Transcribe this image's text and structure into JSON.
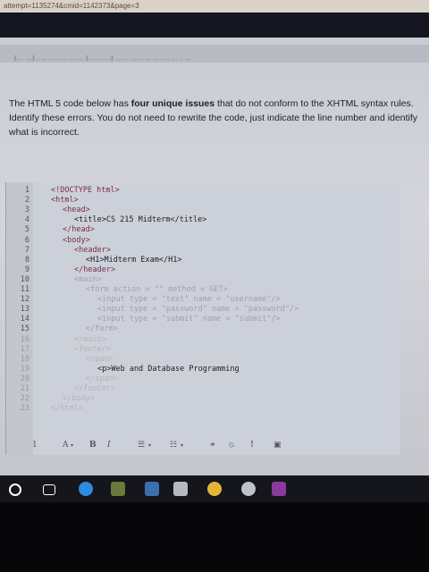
{
  "browser": {
    "url_fragment": "attempt=1135274&cmid=1142373&page=3"
  },
  "header": {
    "blurred_text": "(… …) ,  ………… …… (……….) …… ……… ……, … . …"
  },
  "question": {
    "part1": "The HTML 5 code below has ",
    "bold": "four unique issues",
    "part2": " that do not conform to the XHTML syntax rules. Identify these errors. You do not need to rewrite the code, just indicate the line number and identify what is incorrect."
  },
  "code_lines": [
    {
      "n": "1",
      "t": "<!DOCTYPE html>"
    },
    {
      "n": "2",
      "t": "<html>"
    },
    {
      "n": "3",
      "t": "<head>"
    },
    {
      "n": "4",
      "t": "<title>CS 215 Midterm</title>"
    },
    {
      "n": "5",
      "t": "</head>"
    },
    {
      "n": "6",
      "t": "<body>"
    },
    {
      "n": "7",
      "t": "<header>"
    },
    {
      "n": "8",
      "t": "<H1>Midterm Exam</H1>"
    },
    {
      "n": "9",
      "t": "</header>"
    },
    {
      "n": "10",
      "t": "<main>"
    },
    {
      "n": "11",
      "t": "<form action = \"\" method = GET>"
    },
    {
      "n": "12",
      "t": "<input type = \"text\" name = \"username\"/>"
    },
    {
      "n": "13",
      "t": "<input type = \"password\" name = \"password\"/>"
    },
    {
      "n": "14",
      "t": "<input type = \"submit\" name = \"submit\"/>"
    },
    {
      "n": "15",
      "t": "</form>"
    },
    {
      "n": "16",
      "t": "</main>"
    },
    {
      "n": "17",
      "t": "<footer>"
    },
    {
      "n": "18",
      "t": "<span>"
    },
    {
      "n": "19",
      "t": "<p>Web and Database Programming"
    },
    {
      "n": "20",
      "t": "</span>"
    },
    {
      "n": "21",
      "t": "</footer>"
    },
    {
      "n": "22",
      "t": "</body>"
    },
    {
      "n": "23",
      "t": "</html>"
    }
  ],
  "editor_toolbar": {
    "list_number": "1",
    "font_color": "A",
    "bold": "B",
    "italic": "I",
    "bullet_list": "☰",
    "numbered_list": "☷",
    "link": "⚭",
    "unlink": "⦸",
    "special": "!",
    "image": "▣"
  },
  "taskbar": {
    "icons": [
      "start-icon",
      "task-view-icon",
      "edge-icon",
      "store-icon",
      "mail-icon",
      "photos-icon",
      "chrome-icon",
      "camera-icon",
      "app-icon"
    ],
    "colors": [
      "#ffffff",
      "#ffffff",
      "#2f8ae0",
      "#6b7a3a",
      "#3a6fb0",
      "#b8b8c0",
      "#e2b53a",
      "#c0c2c8",
      "#8a3a9a"
    ]
  }
}
